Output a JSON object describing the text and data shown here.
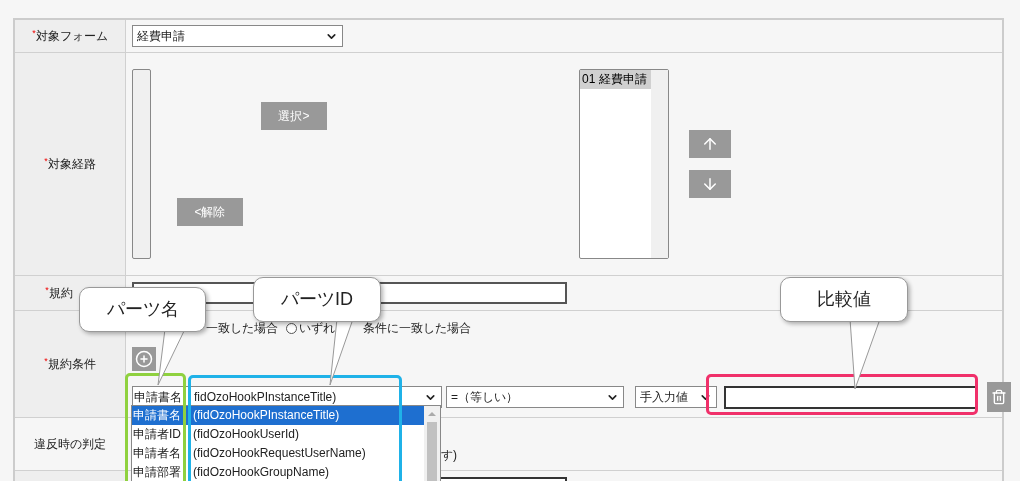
{
  "form": {
    "target_form": {
      "label": "対象フォーム",
      "mark": "*",
      "value": "経費申請"
    },
    "target_route": {
      "label": "対象経路",
      "mark": "*",
      "select_button": "選択>",
      "remove_button": "<解除",
      "chosen": [
        {
          "text": "01 経費申請",
          "selected": true
        }
      ]
    },
    "rule_name": {
      "label": "規約",
      "mark": "*"
    },
    "rule_conditions": {
      "label": "規約条件",
      "mark": "*",
      "match_text": "一致した場合",
      "match_option": {
        "text_before": "いずれ",
        "text_after": "条件に一致した場合",
        "selected": false
      },
      "condition": {
        "field": {
          "name": "申請書名",
          "id": "fidOzoHookPInstanceTitle)"
        },
        "operator": "=（等しい）",
        "source": "手入力値"
      },
      "field_options": [
        {
          "name": "申請書名",
          "id": "(fidOzoHookPInstanceTitle)",
          "selected": true
        },
        {
          "name": "申請者ID",
          "id": "(fidOzoHookUserId)",
          "selected": false
        },
        {
          "name": "申請者名",
          "id": "(fidOzoHookRequestUserName)",
          "selected": false
        },
        {
          "name": "申請部署",
          "id": "(fidOzoHookGroupName)",
          "selected": false
        }
      ]
    },
    "violation": {
      "label": "違反時の判定",
      "fragment": "す)"
    }
  },
  "highlights": [
    {
      "color": "#8fd13f"
    },
    {
      "color": "#1fb2e8"
    },
    {
      "color": "#f0306a"
    }
  ],
  "callouts": [
    {
      "text": "パーツ名"
    },
    {
      "text": "パーツID"
    },
    {
      "text": "比較値"
    }
  ]
}
